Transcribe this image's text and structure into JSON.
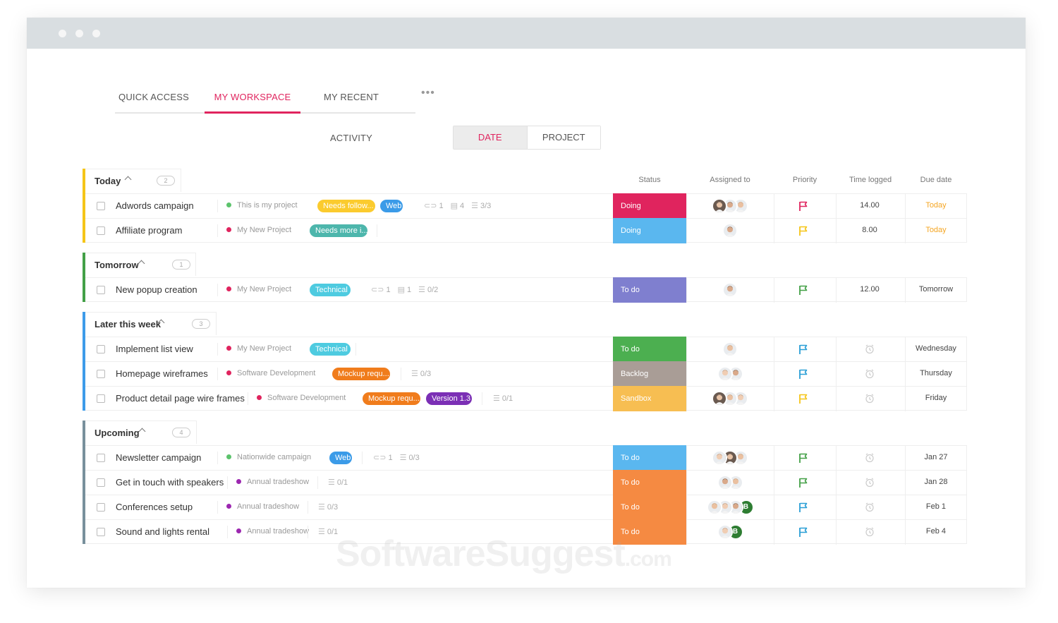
{
  "tabs": [
    {
      "label": "QUICK ACCESS",
      "active": false
    },
    {
      "label": "MY WORKSPACE",
      "active": true
    },
    {
      "label": "MY RECENT ACTIVITY",
      "active": false
    }
  ],
  "tab_more": "•••",
  "view_toggle": {
    "options": [
      "DATE",
      "PROJECT"
    ],
    "selected": "DATE"
  },
  "columns": {
    "status": "Status",
    "assigned": "Assigned to",
    "priority": "Priority",
    "time": "Time logged",
    "due": "Due date"
  },
  "groups": [
    {
      "title": "Today",
      "count": "2",
      "color": "#f5c518",
      "tasks": [
        {
          "name": "Adwords campaign",
          "project": "This is my project",
          "project_color": "#5cc36c",
          "tags": [
            {
              "label": "Needs follow...",
              "color": "#fbcb2e"
            },
            {
              "label": "Web",
              "color": "#3b9be8"
            }
          ],
          "links": "1",
          "comments": "4",
          "subtasks": "3/3",
          "status": "Doing",
          "status_color": "#e0245e",
          "avatars": [
            "p",
            "p",
            "p"
          ],
          "priority_color": "#e0245e",
          "time": "14.00",
          "due": "Today",
          "due_today": true
        },
        {
          "name": "Affiliate program",
          "project": "My New Project",
          "project_color": "#e0245e",
          "tags": [
            {
              "label": "Needs more i...",
              "color": "#4db6ac"
            }
          ],
          "links": "",
          "comments": "",
          "subtasks": "",
          "status": "Doing",
          "status_color": "#5ab7ef",
          "avatars": [
            "p"
          ],
          "priority_color": "#f5c518",
          "time": "8.00",
          "due": "Today",
          "due_today": true
        }
      ]
    },
    {
      "title": "Tomorrow",
      "count": "1",
      "color": "#43a047",
      "tasks": [
        {
          "name": "New popup creation",
          "project": "My New Project",
          "project_color": "#e0245e",
          "tags": [
            {
              "label": "Technical",
              "color": "#4ecbe0"
            }
          ],
          "links": "1",
          "comments": "1",
          "subtasks": "0/2",
          "status": "To do",
          "status_color": "#7f7fcf",
          "avatars": [
            "p"
          ],
          "priority_color": "#43a047",
          "time": "12.00",
          "due": "Tomorrow",
          "due_today": false
        }
      ]
    },
    {
      "title": "Later this week",
      "count": "3",
      "color": "#3d9be9",
      "tasks": [
        {
          "name": "Implement list view",
          "project": "My New Project",
          "project_color": "#e0245e",
          "tags": [
            {
              "label": "Technical",
              "color": "#4ecbe0"
            }
          ],
          "links": "",
          "comments": "",
          "subtasks": "",
          "status": "To do",
          "status_color": "#4caf50",
          "avatars": [
            "p"
          ],
          "priority_color": "#2a9fd6",
          "time": "",
          "due": "Wednesday",
          "due_today": false
        },
        {
          "name": "Homepage wireframes",
          "project": "Software Development",
          "project_color": "#e0245e",
          "tags": [
            {
              "label": "Mockup requ...",
              "color": "#f07c1c"
            }
          ],
          "links": "",
          "comments": "",
          "subtasks": "0/3",
          "status": "Backlog",
          "status_color": "#a99d96",
          "avatars": [
            "p",
            "p"
          ],
          "priority_color": "#2a9fd6",
          "time": "",
          "due": "Thursday",
          "due_today": false
        },
        {
          "name": "Product detail page wire frames",
          "project": "Software Development",
          "project_color": "#e0245e",
          "tags": [
            {
              "label": "Mockup requ...",
              "color": "#f07c1c"
            },
            {
              "label": "Version 1.3",
              "color": "#7b2fb5"
            }
          ],
          "links": "",
          "comments": "",
          "subtasks": "0/1",
          "status": "Sandbox",
          "status_color": "#f7be52",
          "avatars": [
            "p",
            "p",
            "p"
          ],
          "priority_color": "#f5c518",
          "time": "",
          "due": "Friday",
          "due_today": false
        }
      ]
    },
    {
      "title": "Upcoming",
      "count": "4",
      "color": "#78909c",
      "tasks": [
        {
          "name": "Newsletter campaign",
          "project": "Nationwide campaign",
          "project_color": "#5cc36c",
          "tags": [
            {
              "label": "Web",
              "color": "#3b9be8"
            }
          ],
          "links": "1",
          "comments": "",
          "subtasks": "0/3",
          "status": "To do",
          "status_color": "#5ab7ef",
          "avatars": [
            "p",
            "p",
            "p"
          ],
          "priority_color": "#43a047",
          "time": "",
          "due": "Jan 27",
          "due_today": false
        },
        {
          "name": "Get in touch with speakers",
          "project": "Annual tradeshow",
          "project_color": "#9c27b0",
          "tags": [],
          "links": "",
          "comments": "",
          "subtasks": "0/1",
          "status": "To do",
          "status_color": "#f58a42",
          "avatars": [
            "p",
            "p"
          ],
          "priority_color": "#43a047",
          "time": "",
          "due": "Jan 28",
          "due_today": false
        },
        {
          "name": "Conferences setup",
          "project": "Annual tradeshow",
          "project_color": "#9c27b0",
          "tags": [],
          "links": "",
          "comments": "",
          "subtasks": "0/3",
          "status": "To do",
          "status_color": "#f58a42",
          "avatars": [
            "p",
            "p",
            "p",
            "B"
          ],
          "priority_color": "#2a9fd6",
          "time": "",
          "due": "Feb 1",
          "due_today": false
        },
        {
          "name": "Sound and lights rental",
          "project": "Annual tradeshow",
          "project_color": "#9c27b0",
          "tags": [],
          "links": "",
          "comments": "",
          "subtasks": "0/1",
          "status": "To do",
          "status_color": "#f58a42",
          "avatars": [
            "p",
            "B"
          ],
          "priority_color": "#2a9fd6",
          "time": "",
          "due": "Feb 4",
          "due_today": false
        }
      ]
    }
  ],
  "watermark": {
    "main": "SoftwareSuggest",
    "suffix": ".com"
  }
}
